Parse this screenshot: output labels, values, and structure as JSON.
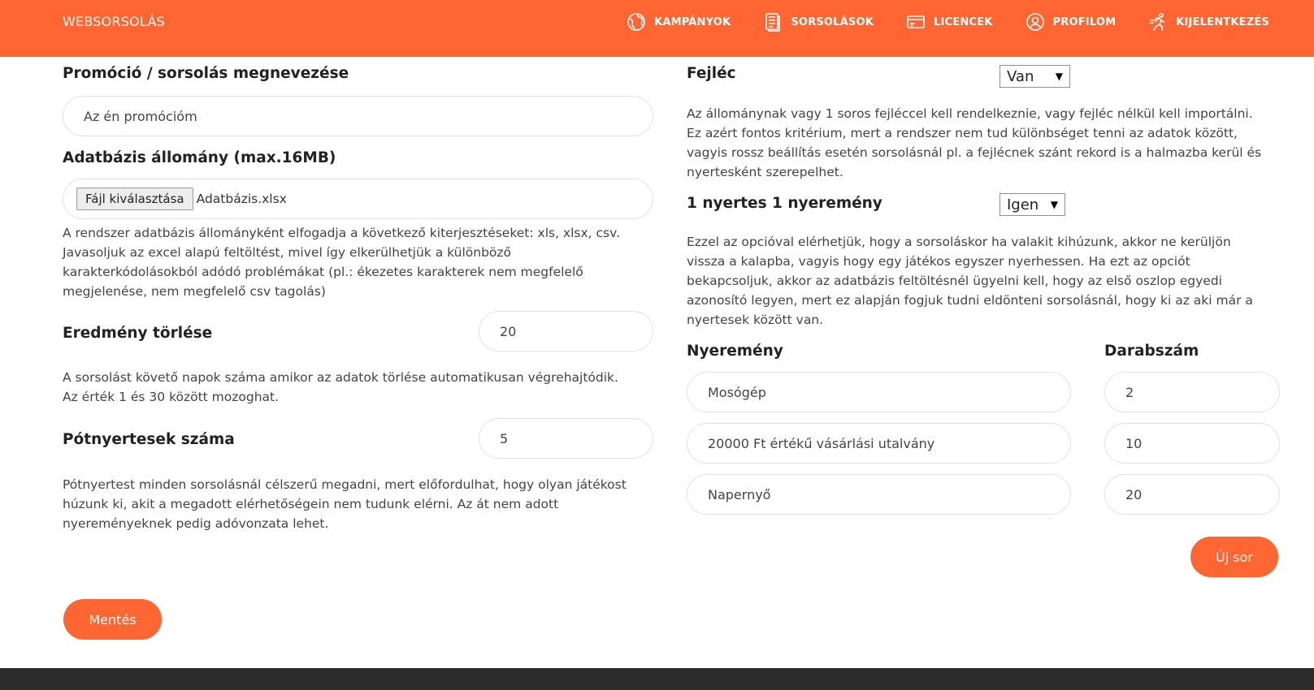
{
  "header": {
    "brand": "WEBSORSOLÁS",
    "nav": [
      {
        "label": "KAMPÁNYOK",
        "icon": "globe-icon"
      },
      {
        "label": "SORSOLÁSOK",
        "icon": "document-icon"
      },
      {
        "label": "LICENCEK",
        "icon": "card-icon"
      },
      {
        "label": "PROFILOM",
        "icon": "profile-icon"
      },
      {
        "label": "KIJELENTKEZÉS",
        "icon": "running-person-icon"
      }
    ]
  },
  "left": {
    "promo_label": "Promóció / sorsolás megnevezése",
    "promo_value": "Az én promócióm",
    "db_label": "Adatbázis állomány (max.16MB)",
    "file_button": "Fájl kiválasztása",
    "file_name": "Adatbázis.xlsx",
    "db_desc_lines": [
      "A rendszer adatbázis állományként elfogadja a következő kiterjesztéseket: xls, xlsx, csv.",
      "Javasoljuk az excel alapú feltöltést, mivel így elkerülhetjük a különböző",
      "karakterkódolásokból adódó problémákat (pl.: ékezetes karakterek nem megfelelő",
      "megjelenése, nem megfelelő csv tagolás)"
    ],
    "delete_label": "Eredmény törlése",
    "delete_value": "20",
    "delete_desc_lines": [
      "A sorsolást követő napok száma amikor az adatok törlése automatikusan végrehajtódik.",
      "Az érték 1 és 30 között mozoghat."
    ],
    "extra_label": "Pótnyertesek száma",
    "extra_value": "5",
    "extra_desc_lines": [
      "Pótnyertest minden sorsolásnál célszerű megadni, mert előfordulhat, hogy olyan játékost",
      "húzunk ki, akit a megadott elérhetőségein nem tudunk elérni. Az át nem adott",
      "nyereményeknek pedig adóvonzata lehet."
    ],
    "save_button": "Mentés"
  },
  "right": {
    "header_label": "Fejléc",
    "header_value": "Van",
    "header_desc_lines": [
      "Az állománynak vagy 1 soros fejléccel kell rendelkeznie, vagy fejléc nélkül kell importálni.",
      "Ez azért fontos kritérium, mert a rendszer nem tud különbséget tenni az adatok között,",
      "vagyis rossz beállítás esetén sorsolásnál pl. a fejlécnek szánt rekord is a halmazba kerül és",
      "nyertesként szerepelhet."
    ],
    "one_winner_label": "1 nyertes 1 nyeremény",
    "one_winner_value": "Igen",
    "one_winner_desc_lines": [
      "Ezzel az opcióval elérhetjük, hogy a sorsoláskor ha valakit kihúzunk, akkor ne kerüljön",
      "vissza a kalapba, vagyis hogy egy játékos egyszer nyerhessen. Ha ezt az opciót",
      "bekapcsoljuk, akkor az adatbázis feltöltésnél ügyelni kell, hogy az első oszlop egyedi",
      "azonosító legyen, mert ez alapján fogjuk tudni eldönteni sorsolásnál, hogy ki az aki már a",
      "nyertesek között van."
    ],
    "prize_col": "Nyeremény",
    "qty_col": "Darabszám",
    "prizes": [
      {
        "name": "Mosógép",
        "qty": "2"
      },
      {
        "name": "20000 Ft értékű vásárlási utalvány",
        "qty": "10"
      },
      {
        "name": "Napernyő",
        "qty": "20"
      }
    ],
    "new_row_button": "Új sor"
  },
  "colors": {
    "accent": "#fd6633",
    "footer": "#2a2a2a"
  }
}
